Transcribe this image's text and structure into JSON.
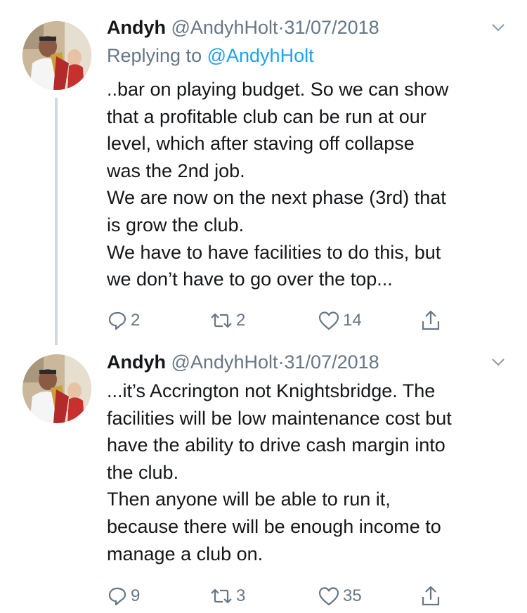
{
  "tweets": [
    {
      "name": "Andyh",
      "handle": "@AndyhHolt",
      "separator": "·",
      "date": "31/07/2018",
      "replying_prefix": "Replying to",
      "replying_to": "@AndyhHolt",
      "lines": [
        "..bar on playing budget. So we can show",
        "that a profitable club can be run at our",
        "level, which after staving off collapse",
        "was the 2nd job.",
        "We are now on the next phase (3rd) that",
        "is grow the club.",
        "We have to have facilities to do this, but",
        "we don’t have to go over the top..."
      ],
      "replies": "2",
      "retweets": "2",
      "likes": "14"
    },
    {
      "name": "Andyh",
      "handle": "@AndyhHolt",
      "separator": "·",
      "date": "31/07/2018",
      "lines": [
        "...it’s Accrington not Knightsbridge. The",
        "facilities will be low maintenance cost but",
        "have the ability to drive cash margin into",
        "the club.",
        "Then anyone will be able to run it,",
        "because there will be enough income to",
        "manage a club on."
      ],
      "replies": "9",
      "retweets": "3",
      "likes": "35"
    }
  ],
  "colors": {
    "link": "#1da1f2",
    "secondary": "#657786",
    "text": "#14171a",
    "thread_line": "#cfd9de"
  },
  "icons": [
    "chevron-down-icon",
    "reply-icon",
    "retweet-icon",
    "like-icon",
    "share-icon"
  ]
}
